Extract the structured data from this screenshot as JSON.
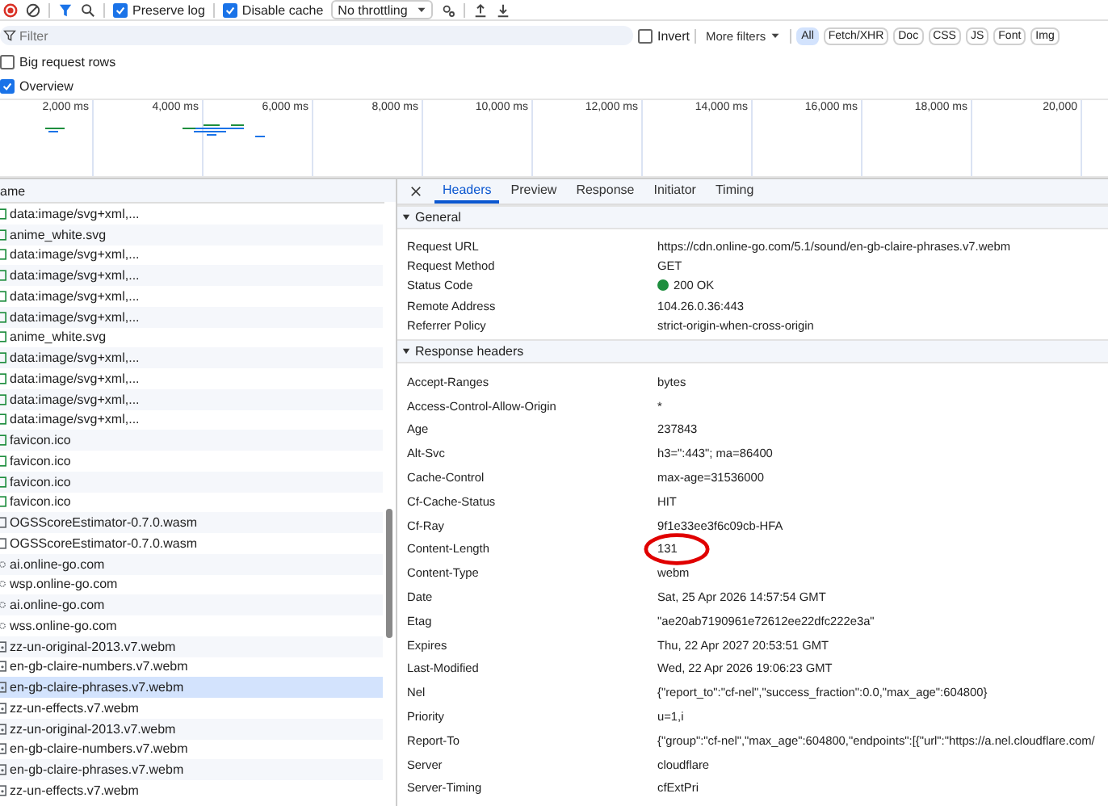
{
  "toolbar": {
    "preserve_log": {
      "label": "Preserve log",
      "checked": true
    },
    "disable_cache": {
      "label": "Disable cache",
      "checked": true
    },
    "throttling": "No throttling"
  },
  "filter_bar": {
    "placeholder": "Filter",
    "invert": {
      "label": "Invert",
      "checked": false
    },
    "more_filters": "More filters",
    "type_filters": [
      {
        "label": "All",
        "selected": true
      },
      {
        "label": "Fetch/XHR",
        "selected": false
      },
      {
        "label": "Doc",
        "selected": false
      },
      {
        "label": "CSS",
        "selected": false
      },
      {
        "label": "JS",
        "selected": false
      },
      {
        "label": "Font",
        "selected": false
      },
      {
        "label": "Img",
        "selected": false
      }
    ]
  },
  "options": [
    {
      "label": "Big request rows",
      "checked": false
    },
    {
      "label": "Overview",
      "checked": true
    }
  ],
  "timeline": {
    "ticks": [
      "2,000 ms",
      "4,000 ms",
      "6,000 ms",
      "8,000 ms",
      "10,000 ms",
      "12,000 ms",
      "14,000 ms",
      "16,000 ms",
      "18,000 ms",
      "20,000"
    ]
  },
  "requests": {
    "column": "ame",
    "rows": [
      {
        "name": "data:image/svg+xml,...",
        "kind": "image",
        "selected": false
      },
      {
        "name": "anime_white.svg",
        "kind": "image",
        "selected": false
      },
      {
        "name": "data:image/svg+xml,...",
        "kind": "image",
        "selected": false
      },
      {
        "name": "data:image/svg+xml,...",
        "kind": "image",
        "selected": false
      },
      {
        "name": "data:image/svg+xml,...",
        "kind": "image",
        "selected": false
      },
      {
        "name": "data:image/svg+xml,...",
        "kind": "image",
        "selected": false
      },
      {
        "name": "anime_white.svg",
        "kind": "image",
        "selected": false
      },
      {
        "name": "data:image/svg+xml,...",
        "kind": "image",
        "selected": false
      },
      {
        "name": "data:image/svg+xml,...",
        "kind": "image",
        "selected": false
      },
      {
        "name": "data:image/svg+xml,...",
        "kind": "image",
        "selected": false
      },
      {
        "name": "data:image/svg+xml,...",
        "kind": "image",
        "selected": false
      },
      {
        "name": "favicon.ico",
        "kind": "image",
        "selected": false
      },
      {
        "name": "favicon.ico",
        "kind": "image",
        "selected": false
      },
      {
        "name": "favicon.ico",
        "kind": "image",
        "selected": false
      },
      {
        "name": "favicon.ico",
        "kind": "image",
        "selected": false
      },
      {
        "name": "OGSScoreEstimator-0.7.0.wasm",
        "kind": "file",
        "selected": false
      },
      {
        "name": "OGSScoreEstimator-0.7.0.wasm",
        "kind": "file",
        "selected": false
      },
      {
        "name": "ai.online-go.com",
        "kind": "websocket",
        "selected": false
      },
      {
        "name": "wsp.online-go.com",
        "kind": "websocket",
        "selected": false
      },
      {
        "name": "ai.online-go.com",
        "kind": "websocket",
        "selected": false
      },
      {
        "name": "wss.online-go.com",
        "kind": "websocket",
        "selected": false
      },
      {
        "name": "zz-un-original-2013.v7.webm",
        "kind": "media",
        "selected": false
      },
      {
        "name": "en-gb-claire-numbers.v7.webm",
        "kind": "media",
        "selected": false
      },
      {
        "name": "en-gb-claire-phrases.v7.webm",
        "kind": "media",
        "selected": true
      },
      {
        "name": "zz-un-effects.v7.webm",
        "kind": "media",
        "selected": false
      },
      {
        "name": "zz-un-original-2013.v7.webm",
        "kind": "media",
        "selected": false
      },
      {
        "name": "en-gb-claire-numbers.v7.webm",
        "kind": "media",
        "selected": false
      },
      {
        "name": "en-gb-claire-phrases.v7.webm",
        "kind": "media",
        "selected": false
      },
      {
        "name": "zz-un-effects.v7.webm",
        "kind": "media",
        "selected": false
      }
    ]
  },
  "details": {
    "tabs": [
      {
        "label": "Headers",
        "selected": true
      },
      {
        "label": "Preview",
        "selected": false
      },
      {
        "label": "Response",
        "selected": false
      },
      {
        "label": "Initiator",
        "selected": false
      },
      {
        "label": "Timing",
        "selected": false
      }
    ],
    "sections": [
      {
        "title": "General",
        "expanded": true,
        "rows": [
          {
            "name": "Request URL",
            "value": "https://cdn.online-go.com/5.1/sound/en-gb-claire-phrases.v7.webm"
          },
          {
            "name": "Request Method",
            "value": "GET"
          },
          {
            "name": "Status Code",
            "value": "200 OK",
            "color": "#1e8e3e"
          },
          {
            "name": "Remote Address",
            "value": "104.26.0.36:443"
          },
          {
            "name": "Referrer Policy",
            "value": "strict-origin-when-cross-origin"
          }
        ]
      },
      {
        "title": "Response headers",
        "expanded": true,
        "rows": [
          {
            "name": "Accept-Ranges",
            "value": "bytes"
          },
          {
            "name": "Access-Control-Allow-Origin",
            "value": "*"
          },
          {
            "name": "Age",
            "value": "237843"
          },
          {
            "name": "Alt-Svc",
            "value": "h3=\":443\"; ma=86400"
          },
          {
            "name": "Cache-Control",
            "value": "max-age=31536000"
          },
          {
            "name": "Cf-Cache-Status",
            "value": "HIT"
          },
          {
            "name": "Cf-Ray",
            "value": "9f1e33ee3f6c09cb-HFA"
          },
          {
            "name": "Content-Length",
            "value": "131",
            "circled": true
          },
          {
            "name": "Content-Type",
            "value": "webm"
          },
          {
            "name": "Date",
            "value": "Sat, 25 Apr 2026 14:57:54 GMT"
          },
          {
            "name": "Etag",
            "value": "\"ae20ab7190961e72612ee22dfc222e3a\""
          },
          {
            "name": "Expires",
            "value": "Thu, 22 Apr 2027 20:53:51 GMT"
          },
          {
            "name": "Last-Modified",
            "value": "Wed, 22 Apr 2026 19:06:23 GMT"
          },
          {
            "name": "Nel",
            "value": "{\"report_to\":\"cf-nel\",\"success_fraction\":0.0,\"max_age\":604800}"
          },
          {
            "name": "Priority",
            "value": "u=1,i"
          },
          {
            "name": "Report-To",
            "value": "{\"group\":\"cf-nel\",\"max_age\":604800,\"endpoints\":[{\"url\":\"https://a.nel.cloudflare.com/"
          },
          {
            "name": "Server",
            "value": "cloudflare"
          },
          {
            "name": "Server-Timing",
            "value": "cfExtPri"
          }
        ]
      }
    ]
  }
}
